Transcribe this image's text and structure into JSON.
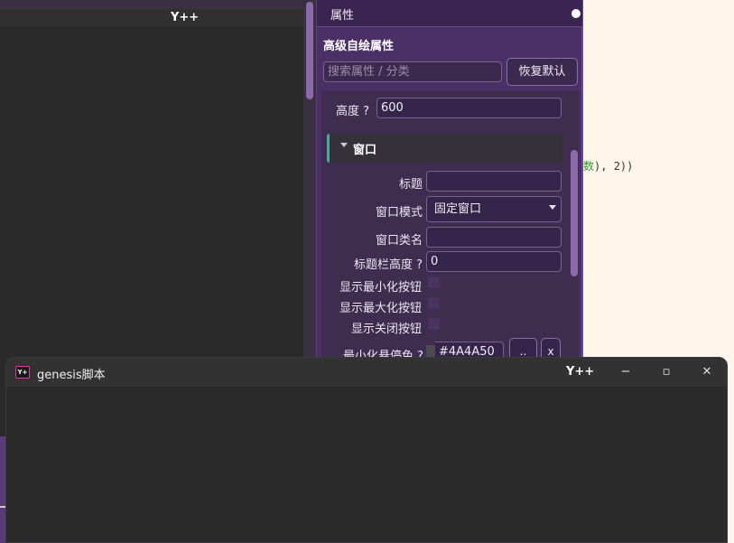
{
  "background_app": {
    "title": "Y++"
  },
  "code_fragment": {
    "highlight": "数",
    "rest": "), 2))"
  },
  "panel": {
    "header": "属性",
    "section_title": "高级自绘属性",
    "search_placeholder": "搜索属性 / 分类",
    "reset_label": "恢复默认",
    "height_label": "高度",
    "height_value": "600",
    "group_window": "窗口",
    "fields": {
      "title_label": "标题",
      "title_value": "",
      "mode_label": "窗口模式",
      "mode_value": "固定窗口",
      "class_label": "窗口类名",
      "class_value": "",
      "titlebar_height_label": "标题栏高度",
      "titlebar_height_value": "0",
      "show_min_label": "显示最小化按钮",
      "show_max_label": "显示最大化按钮",
      "show_close_label": "显示关闭按钮",
      "min_hover_color_label": "最小化悬停色",
      "min_hover_color_value": "#4A4A50",
      "min_hover_color_swatch": "#4A4A50"
    },
    "help_mark": "?",
    "small_btn_1": "..",
    "small_btn_2": "x"
  },
  "genesis_window": {
    "logo_text": "Y+",
    "name": "genesis脚本",
    "app": "Y++",
    "minimize": "−",
    "maximize": "▫",
    "close": "✕"
  }
}
